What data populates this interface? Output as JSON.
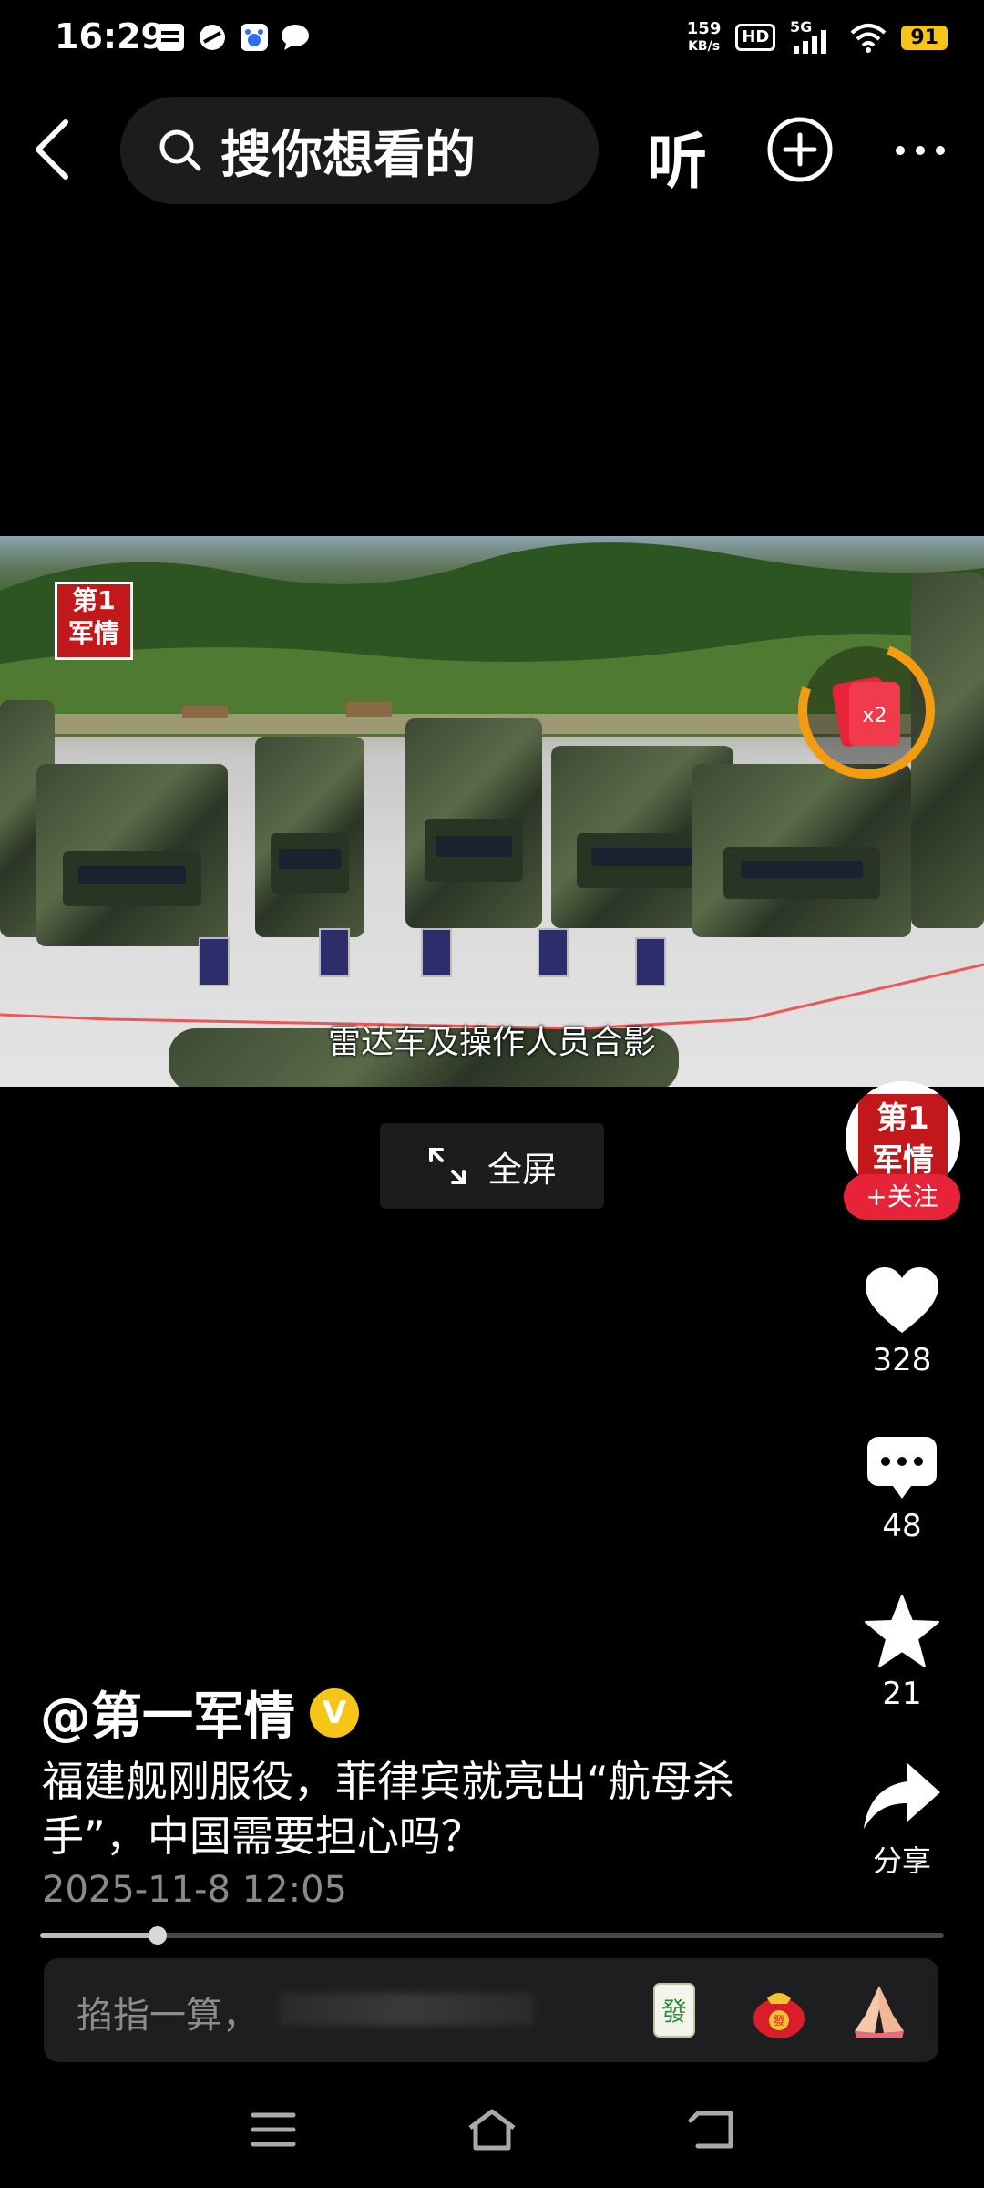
{
  "status_bar": {
    "time": "16:29",
    "network_speed": "159",
    "network_unit": "KB/s",
    "hd": "HD",
    "signal": "5G",
    "battery": "91"
  },
  "top_nav": {
    "search_placeholder": "搜你想看的",
    "listen_label": "听"
  },
  "video": {
    "subtitle": "雷达车及操作人员合影",
    "logo_text": [
      "第1",
      "军情"
    ],
    "bonus_label": "x2"
  },
  "fullscreen_label": "全屏",
  "author": {
    "avatar_text": [
      "第1",
      "军情"
    ],
    "follow_label": "+关注",
    "name": "@第一军情",
    "verified": "V"
  },
  "actions": {
    "likes": "328",
    "comments": "48",
    "favorites": "21",
    "share_label": "分享"
  },
  "post": {
    "title": "福建舰刚服役，菲律宾就亮出“航母杀手”，中国需要担心吗？",
    "date": "2025-11-8 12:05"
  },
  "progress": {
    "played_fraction": 0.13
  },
  "comment_bar": {
    "prompt": "掐指一算，"
  },
  "colors": {
    "accent_red": "#e7233a",
    "badge_yellow": "#f5c518",
    "bonus_orange": "#f39c12"
  }
}
